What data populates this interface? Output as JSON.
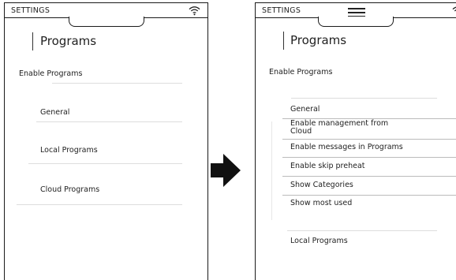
{
  "left_screen": {
    "status_title": "SETTINGS",
    "page_title": "Programs",
    "enable_label": "Enable Programs",
    "items": [
      "General",
      "Local Programs",
      "Cloud Programs"
    ]
  },
  "right_screen": {
    "status_title": "SETTINGS",
    "page_title": "Programs",
    "enable_label": "Enable Programs",
    "general_label": "General",
    "general_options": [
      "Enable management from\nCloud",
      "Enable messages in Programs",
      "Enable skip preheat",
      "Show Categories",
      "Show most used"
    ],
    "local_label": "Local Programs"
  },
  "icons": {
    "wifi": "wifi-icon",
    "menu": "hamburger-menu-icon",
    "transition": "right-arrow-icon"
  },
  "colors": {
    "frame": "#1a1a1a",
    "divider": "#dddddd",
    "background": "#ffffff"
  }
}
